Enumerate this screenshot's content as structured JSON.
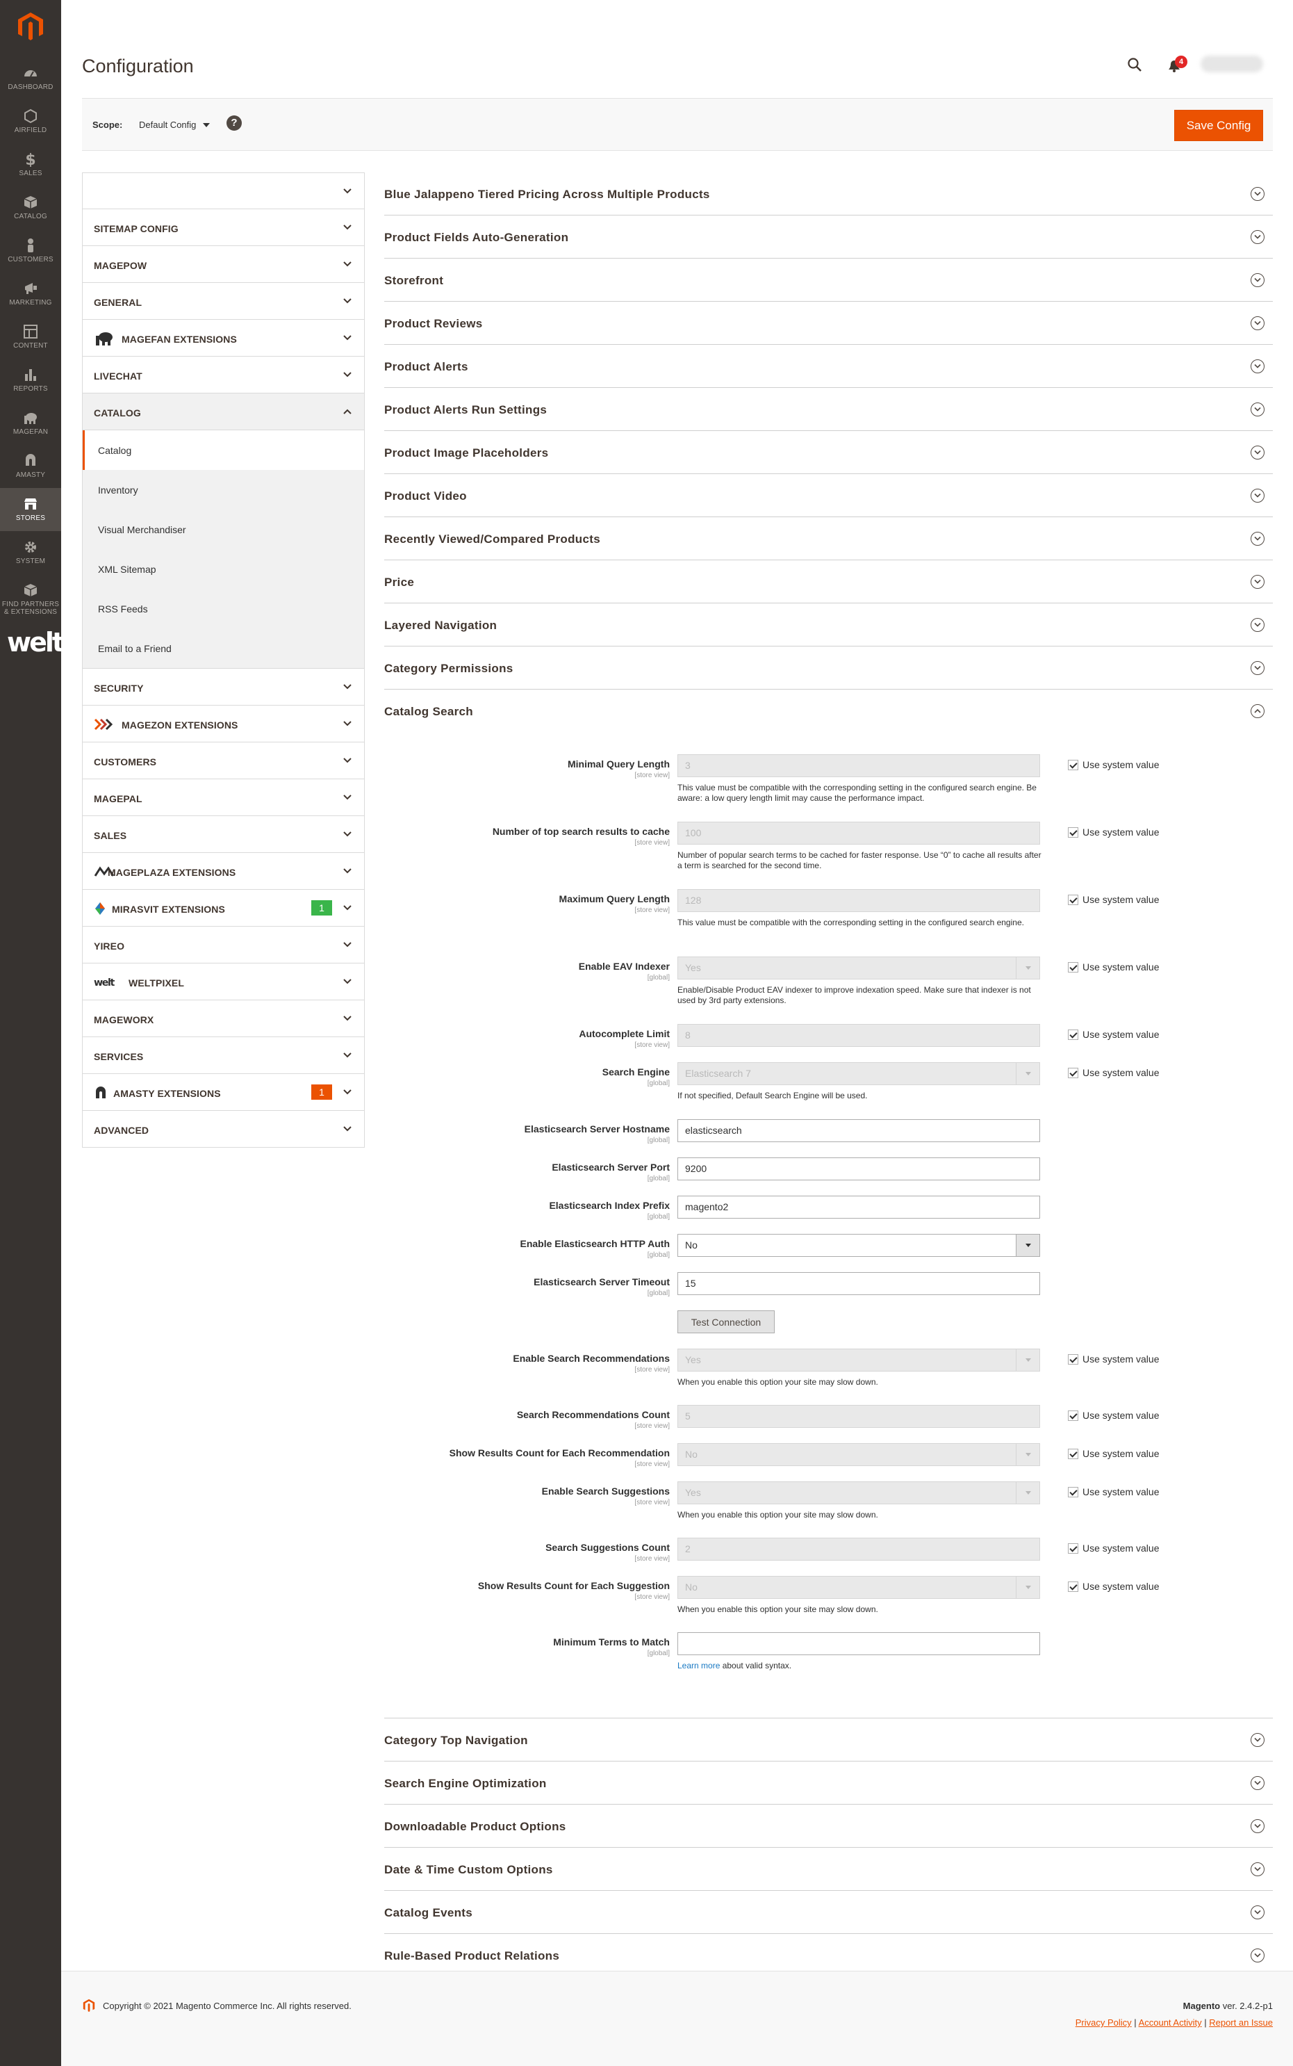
{
  "menu": {
    "items": [
      {
        "label": "Dashboard",
        "icon": "dashboard-icon"
      },
      {
        "label": "Airfield",
        "icon": "hexagon-icon"
      },
      {
        "label": "Sales",
        "icon": "dollar-icon"
      },
      {
        "label": "Catalog",
        "icon": "box-icon"
      },
      {
        "label": "Customers",
        "icon": "person-icon"
      },
      {
        "label": "Marketing",
        "icon": "megaphone-icon"
      },
      {
        "label": "Content",
        "icon": "layout-icon"
      },
      {
        "label": "Reports",
        "icon": "bar-chart-icon"
      },
      {
        "label": "Magefan",
        "icon": "elephant-icon"
      },
      {
        "label": "Amasty",
        "icon": "amasty-icon"
      },
      {
        "label": "Stores",
        "icon": "store-icon"
      },
      {
        "label": "System",
        "icon": "gear-icon"
      },
      {
        "label": "Find Partners & Extensions",
        "icon": "cube-icon"
      }
    ],
    "brand": "welt"
  },
  "header": {
    "title": "Configuration",
    "notifications": "4"
  },
  "scope": {
    "label": "Scope:",
    "value": "Default Config",
    "help": "?",
    "save_label": "Save Config"
  },
  "tabs": [
    {
      "label": ""
    },
    {
      "label": "Sitemap Config"
    },
    {
      "label": "Magepow"
    },
    {
      "label": "General"
    },
    {
      "label": "Magefan Extensions"
    },
    {
      "label": "Livechat"
    },
    {
      "label": "Catalog"
    },
    {
      "label": "Security"
    },
    {
      "label": "Magezon Extensions"
    },
    {
      "label": "Customers"
    },
    {
      "label": "Magepal"
    },
    {
      "label": "Sales"
    },
    {
      "label": "Mageplaza Extensions"
    },
    {
      "label": "Mirasvit Extensions",
      "badge": "1"
    },
    {
      "label": "Yireo"
    },
    {
      "label": "Weltpixel"
    },
    {
      "label": "Mageworx"
    },
    {
      "label": "Services"
    },
    {
      "label": "Amasty Extensions",
      "badge": "1"
    },
    {
      "label": "Advanced"
    }
  ],
  "catalog_sub": [
    "Catalog",
    "Inventory",
    "Visual Merchandiser",
    "XML Sitemap",
    "RSS Feeds",
    "Email to a Friend"
  ],
  "sections_top": [
    "Blue Jalappeno Tiered Pricing Across Multiple Products",
    "Product Fields Auto-Generation",
    "Storefront",
    "Product Reviews",
    "Product Alerts",
    "Product Alerts Run Settings",
    "Product Image Placeholders",
    "Product Video",
    "Recently Viewed/Compared Products",
    "Price",
    "Layered Navigation",
    "Category Permissions",
    "Catalog Search"
  ],
  "sections_bottom": [
    "Category Top Navigation",
    "Search Engine Optimization",
    "Downloadable Product Options",
    "Date & Time Custom Options",
    "Catalog Events",
    "Rule-Based Product Relations"
  ],
  "use_system": "Use system value",
  "fields": [
    {
      "label": "Minimal Query Length",
      "scope": "[store view]",
      "value": "3",
      "note": "This value must be compatible with the corresponding setting in the configured search engine. Be aware: a low query length limit may cause the performance impact."
    },
    {
      "label": "Number of top search results to cache",
      "scope": "[store view]",
      "value": "100",
      "note": "Number of popular search terms to be cached for faster response. Use “0” to cache all results after a term is searched for the second time."
    },
    {
      "label": "Maximum Query Length",
      "scope": "[store view]",
      "value": "128",
      "note": "This value must be compatible with the corresponding setting in the configured search engine."
    },
    {
      "label": "Enable EAV Indexer",
      "scope": "[global]",
      "value": "Yes",
      "note": "Enable/Disable Product EAV indexer to improve indexation speed. Make sure that indexer is not used by 3rd party extensions."
    },
    {
      "label": "Autocomplete Limit",
      "scope": "[store view]",
      "value": "8"
    },
    {
      "label": "Search Engine",
      "scope": "[global]",
      "value": "Elasticsearch 7",
      "note": "If not specified, Default Search Engine will be used."
    },
    {
      "label": "Elasticsearch Server Hostname",
      "scope": "[global]",
      "value": "elasticsearch"
    },
    {
      "label": "Elasticsearch Server Port",
      "scope": "[global]",
      "value": "9200"
    },
    {
      "label": "Elasticsearch Index Prefix",
      "scope": "[global]",
      "value": "magento2"
    },
    {
      "label": "Enable Elasticsearch HTTP Auth",
      "scope": "[global]",
      "value": "No"
    },
    {
      "label": "Elasticsearch Server Timeout",
      "scope": "[global]",
      "value": "15"
    },
    {
      "label": "Enable Search Recommendations",
      "scope": "[store view]",
      "value": "Yes",
      "note": "When you enable this option your site may slow down."
    },
    {
      "label": "Search Recommendations Count",
      "scope": "[store view]",
      "value": "5"
    },
    {
      "label": "Show Results Count for Each Recommendation",
      "scope": "[store view]",
      "value": "No"
    },
    {
      "label": "Enable Search Suggestions",
      "scope": "[store view]",
      "value": "Yes",
      "note": "When you enable this option your site may slow down."
    },
    {
      "label": "Search Suggestions Count",
      "scope": "[store view]",
      "value": "2"
    },
    {
      "label": "Show Results Count for Each Suggestion",
      "scope": "[store view]",
      "value": "No",
      "note": "When you enable this option your site may slow down."
    },
    {
      "label": "Minimum Terms to Match",
      "scope": "[global]",
      "value": "",
      "note_link": "Learn more",
      "note_rest": " about valid syntax."
    }
  ],
  "test_connection": "Test Connection",
  "footer": {
    "copyright": "Copyright © 2021 Magento Commerce Inc. All rights reserved.",
    "brand": "Magento",
    "version": " ver. 2.4.2-p1",
    "privacy": "Privacy Policy",
    "activity": "Account Activity",
    "issue": "Report an Issue",
    "sep": " | "
  },
  "colors": {
    "accent": "#eb5202",
    "menu_bg": "#373330",
    "green_badge": "#3ab54a"
  }
}
